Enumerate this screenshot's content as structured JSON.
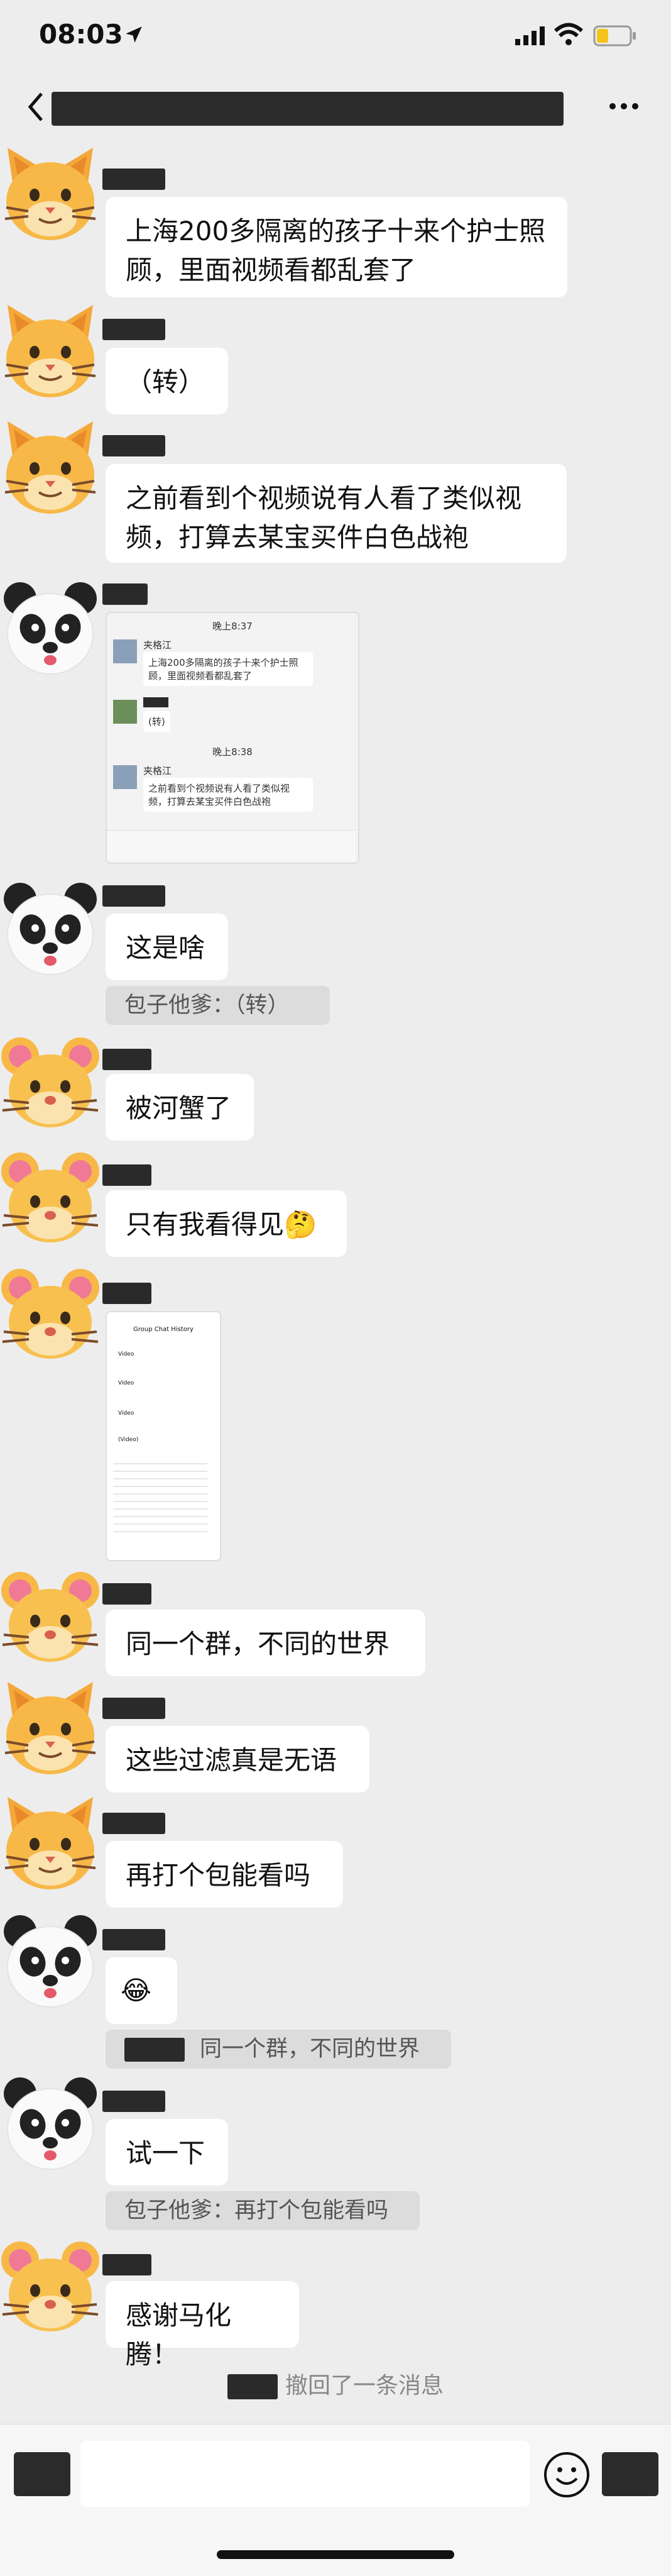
{
  "status_bar": {
    "time": "08:03"
  },
  "messages": [
    {
      "sender": "cat",
      "type": "text",
      "text": "上海200多隔离的孩子十来个护士照顾，里面视频看都乱套了"
    },
    {
      "sender": "cat",
      "type": "text",
      "text": "（转）"
    },
    {
      "sender": "cat",
      "type": "text",
      "text": "之前看到个视频说有人看了类似视频，打算去某宝买件白色战袍"
    },
    {
      "sender": "panda",
      "type": "image_chat",
      "time_label_1": "晚上8:37",
      "mini_name": "夹格江",
      "mini_msg_1": "上海200多隔离的孩子十来个护士照顾，里面视频看都乱套了",
      "mini_msg_2": "(转)",
      "time_label_2": "晚上8:38",
      "mini_msg_3": "之前看到个视频说有人看了类似视频，打算去某宝买件白色战袍"
    },
    {
      "sender": "panda",
      "type": "text",
      "text": "这是啥",
      "quote": "包子他爹：（转）"
    },
    {
      "sender": "mouse",
      "type": "text",
      "text": "被河蟹了"
    },
    {
      "sender": "mouse",
      "type": "text",
      "text": "只有我看得见🤔"
    },
    {
      "sender": "mouse",
      "type": "image_screenshot",
      "header": "Group Chat History",
      "rows": [
        "Video",
        "Video",
        "Video",
        "(Video)"
      ]
    },
    {
      "sender": "mouse",
      "type": "text",
      "text": "同一个群，不同的世界"
    },
    {
      "sender": "cat",
      "type": "text",
      "text": "这些过滤真是无语"
    },
    {
      "sender": "cat",
      "type": "text",
      "text": "再打个包能看吗"
    },
    {
      "sender": "panda",
      "type": "emoji",
      "text": "😂",
      "quote": "同一个群，不同的世界"
    },
    {
      "sender": "panda",
      "type": "text",
      "text": "试一下",
      "quote": "包子他爹：再打个包能看吗"
    },
    {
      "sender": "mouse",
      "type": "text",
      "text": "感谢马化腾！"
    }
  ],
  "recall_notice": "撤回了一条消息",
  "colors": {
    "background": "#ededed",
    "bubble": "#ffffff",
    "redaction": "#2a2a2a"
  },
  "icons": [
    "back-icon",
    "more-icon",
    "location-arrow-icon",
    "signal-icon",
    "wifi-icon",
    "battery-icon",
    "emoji-icon"
  ]
}
